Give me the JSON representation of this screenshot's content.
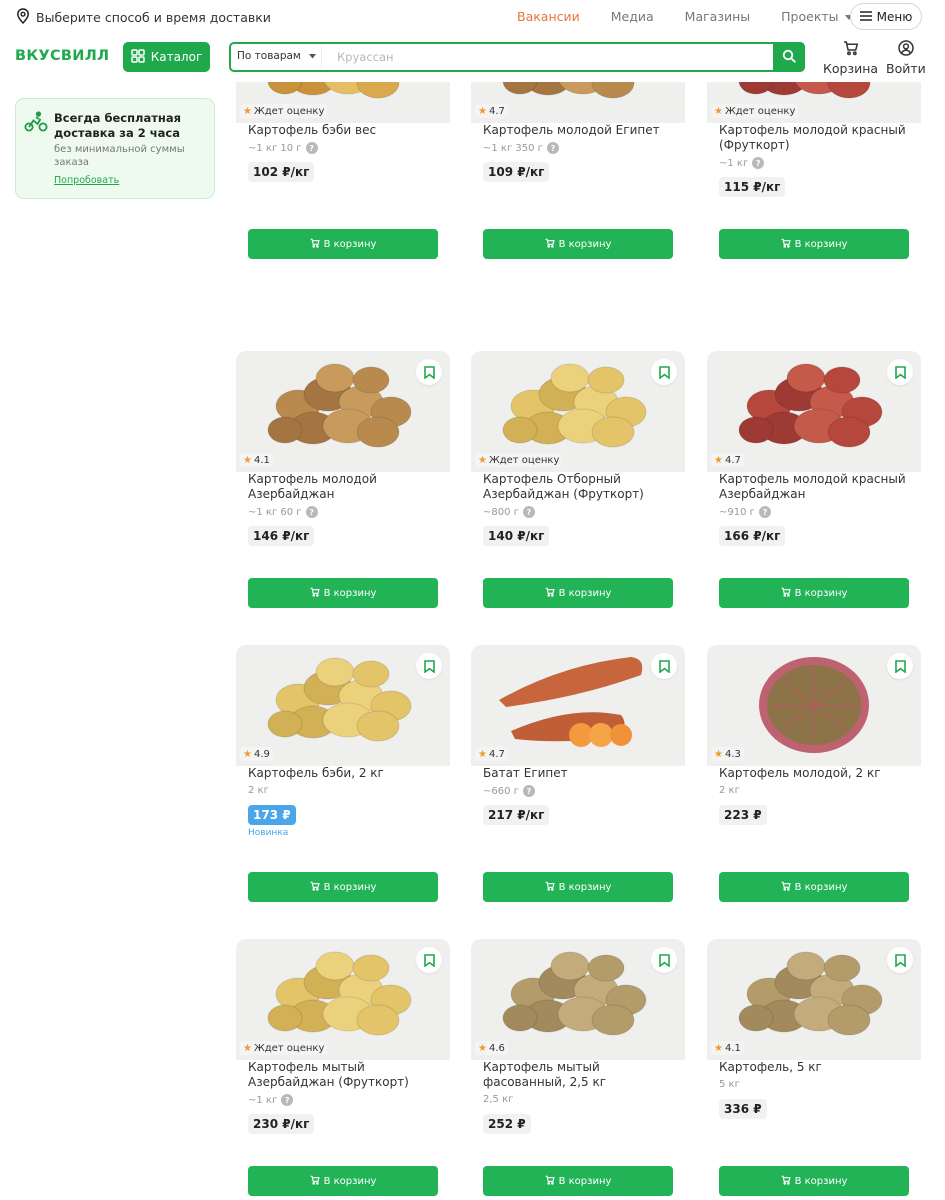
{
  "topbar": {
    "delivery": "Выберите способ и время доставки",
    "nav": [
      "Вакансии",
      "Медиа",
      "Магазины"
    ],
    "projects": "Проекты",
    "menu": "Меню"
  },
  "header": {
    "logo": "ВКУСВИЛЛ",
    "catalog": "Каталог",
    "search_type": "По товарам",
    "search_placeholder": "Круассан",
    "cart": "Корзина",
    "login": "Войти"
  },
  "promo": {
    "title": "Всегда бесплатная доставка за 2 часа",
    "subtitle": "без минимальной суммы заказа",
    "link": "Попробовать"
  },
  "colors": {
    "brand": "#20a84d",
    "button": "#22b357",
    "accent": "#e8763a",
    "new": "#4aa6e8"
  },
  "products": [
    {
      "rating": "Ждет оценку",
      "name": "Картофель бэби вес",
      "weight": "~1 кг 10 г",
      "price": "102 ₽/кг",
      "cart": "В корзину",
      "icon": "baby-potato-image"
    },
    {
      "rating": "4.7",
      "name": "Картофель молодой Египет",
      "weight": "~1 кг 350 г",
      "price": "109 ₽/кг",
      "cart": "В корзину",
      "icon": "egypt-potato-image"
    },
    {
      "rating": "Ждет оценку",
      "name": "Картофель молодой красный (Фруткорт)",
      "weight": "~1 кг",
      "price": "115 ₽/кг",
      "cart": "В корзину",
      "icon": "red-potato-image"
    },
    {
      "rating": "4.1",
      "name": "Картофель молодой Азербайджан",
      "weight": "~1 кг 60 г",
      "price": "146 ₽/кг",
      "cart": "В корзину",
      "icon": "azerbaijan-potato-image"
    },
    {
      "rating": "Ждет оценку",
      "name": "Картофель Отборный Азербайджан (Фруткорт)",
      "weight": "~800 г",
      "price": "140 ₽/кг",
      "cart": "В корзину",
      "icon": "selected-potato-image"
    },
    {
      "rating": "4.7",
      "name": "Картофель молодой красный Азербайджан",
      "weight": "~910 г",
      "price": "166 ₽/кг",
      "cart": "В корзину",
      "icon": "red-azerbaijan-potato-image"
    },
    {
      "rating": "4.9",
      "name": "Картофель бэби, 2 кг",
      "weight": "2 кг",
      "price": "173 ₽",
      "badge": "Новинка",
      "cart": "В корзину",
      "icon": "baby-potato-2kg-image"
    },
    {
      "rating": "4.7",
      "name": "Батат Египет",
      "weight": "~660 г",
      "price": "217 ₽/кг",
      "cart": "В корзину",
      "icon": "sweet-potato-image"
    },
    {
      "rating": "4.3",
      "name": "Картофель молодой, 2 кг",
      "weight": "2 кг",
      "price": "223 ₽",
      "cart": "В корзину",
      "icon": "potato-net-bag-image"
    },
    {
      "rating": "Ждет оценку",
      "name": "Картофель мытый Азербайджан (Фруткорт)",
      "weight": "~1 кг",
      "price": "230 ₽/кг",
      "cart": "В корзину",
      "icon": "washed-potato-image"
    },
    {
      "rating": "4.6",
      "name": "Картофель мытый фасованный, 2,5 кг",
      "weight": "2,5 кг",
      "price": "252 ₽",
      "cart": "В корзину",
      "icon": "packed-potato-image"
    },
    {
      "rating": "4.1",
      "name": "Картофель, 5 кг",
      "weight": "5 кг",
      "price": "336 ₽",
      "cart": "В корзину",
      "icon": "potato-5kg-image"
    }
  ]
}
